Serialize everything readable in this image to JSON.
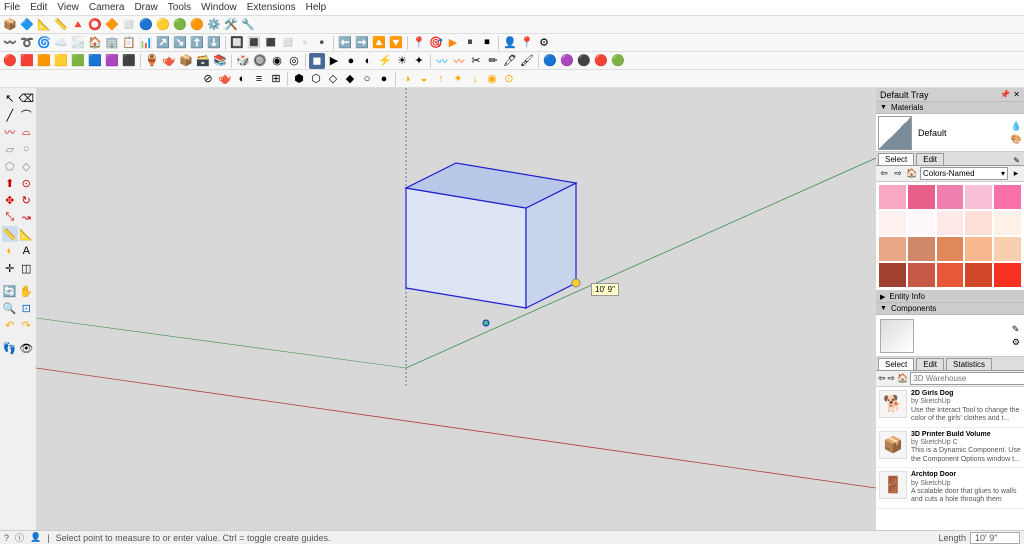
{
  "menu": [
    "File",
    "Edit",
    "View",
    "Camera",
    "Draw",
    "Tools",
    "Window",
    "Extensions",
    "Help"
  ],
  "tray": {
    "title": "Default Tray",
    "materials": {
      "label": "Materials",
      "current": "Default",
      "tabs": [
        "Select",
        "Edit"
      ],
      "collection": "Colors-Named",
      "swatches": [
        "#f8a8c0",
        "#e8608a",
        "#f080b0",
        "#f8c0d8",
        "#f870a8",
        "#fff0f0",
        "#fff8f8",
        "#ffe8e8",
        "#ffe0d8",
        "#fff0e8",
        "#e8a888",
        "#d08868",
        "#e08858",
        "#f8b890",
        "#f8d0b0",
        "#a04030",
        "#c85848",
        "#e85838",
        "#d04828",
        "#f83020"
      ]
    },
    "entity_info": {
      "label": "Entity Info"
    },
    "components": {
      "label": "Components",
      "tabs": [
        "Select",
        "Edit",
        "Statistics"
      ],
      "search_placeholder": "3D Warehouse",
      "items": [
        {
          "title": "2D Girls Dog",
          "by": "by SketchUp",
          "desc": "Use the Interact Tool to change the color of the girls' clothes and t...",
          "thumb": "🐕"
        },
        {
          "title": "3D Printer Build Volume",
          "by": "by SketchUp C",
          "desc": "This is a Dynamic Component. Use the Component Options window t...",
          "thumb": "📦"
        },
        {
          "title": "Archtop Door",
          "by": "by SketchUp",
          "desc": "A scalable door that glues to walls and cuts a hole through them",
          "thumb": "🚪"
        }
      ]
    }
  },
  "viewport": {
    "dimension": "10' 9\""
  },
  "status": {
    "hint": "Select point to measure to or enter value. Ctrl = toggle create guides.",
    "length_label": "Length",
    "length_value": "10' 9\""
  }
}
